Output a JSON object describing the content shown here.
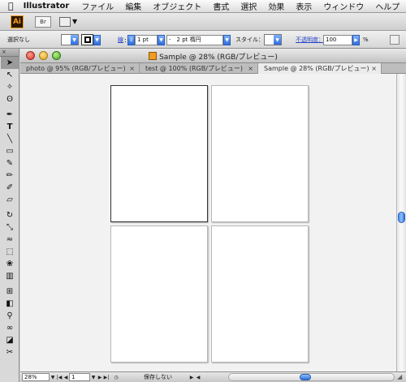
{
  "menubar": {
    "app_name": "Illustrator",
    "items": [
      "ファイル",
      "編集",
      "オブジェクト",
      "書式",
      "選択",
      "効果",
      "表示",
      "ウィンドウ",
      "ヘルプ"
    ]
  },
  "appbar": {
    "logo_text": "Ai",
    "bridge_label": "Br"
  },
  "controlbar": {
    "selection_status": "選択なし",
    "stroke_label": "線",
    "stroke_weight": "1 pt",
    "brush_value": "-　2 pt 楕円",
    "style_label": "スタイル：",
    "opacity_label": "不透明度：",
    "opacity_value": "100",
    "percent_sign": "%"
  },
  "document": {
    "window_title": "Sample @ 28% (RGB/プレビュー)",
    "tabs": [
      {
        "label": "photo @ 95% (RGB/プレビュー)",
        "active": false
      },
      {
        "label": "test @ 100% (RGB/プレビュー)",
        "active": false
      },
      {
        "label": "Sample @ 28% (RGB/プレビュー)",
        "active": true
      }
    ],
    "tab_close_glyph": "×",
    "artboard_count": 4
  },
  "statusbar": {
    "zoom": "28%",
    "artboard_number": "1",
    "status_text": "保存しない"
  },
  "icons": {
    "apple": "apple-icon",
    "selection": "selection-tool-icon",
    "direct_selection": "direct-selection-tool-icon",
    "pen": "pen-tool-icon",
    "type": "type-tool-icon"
  },
  "colors": {
    "accent_blue": "#2d6ee0",
    "ai_orange": "#f29b1d",
    "ai_dark": "#2b1700",
    "canvas_bg": "#f2f2f2"
  }
}
